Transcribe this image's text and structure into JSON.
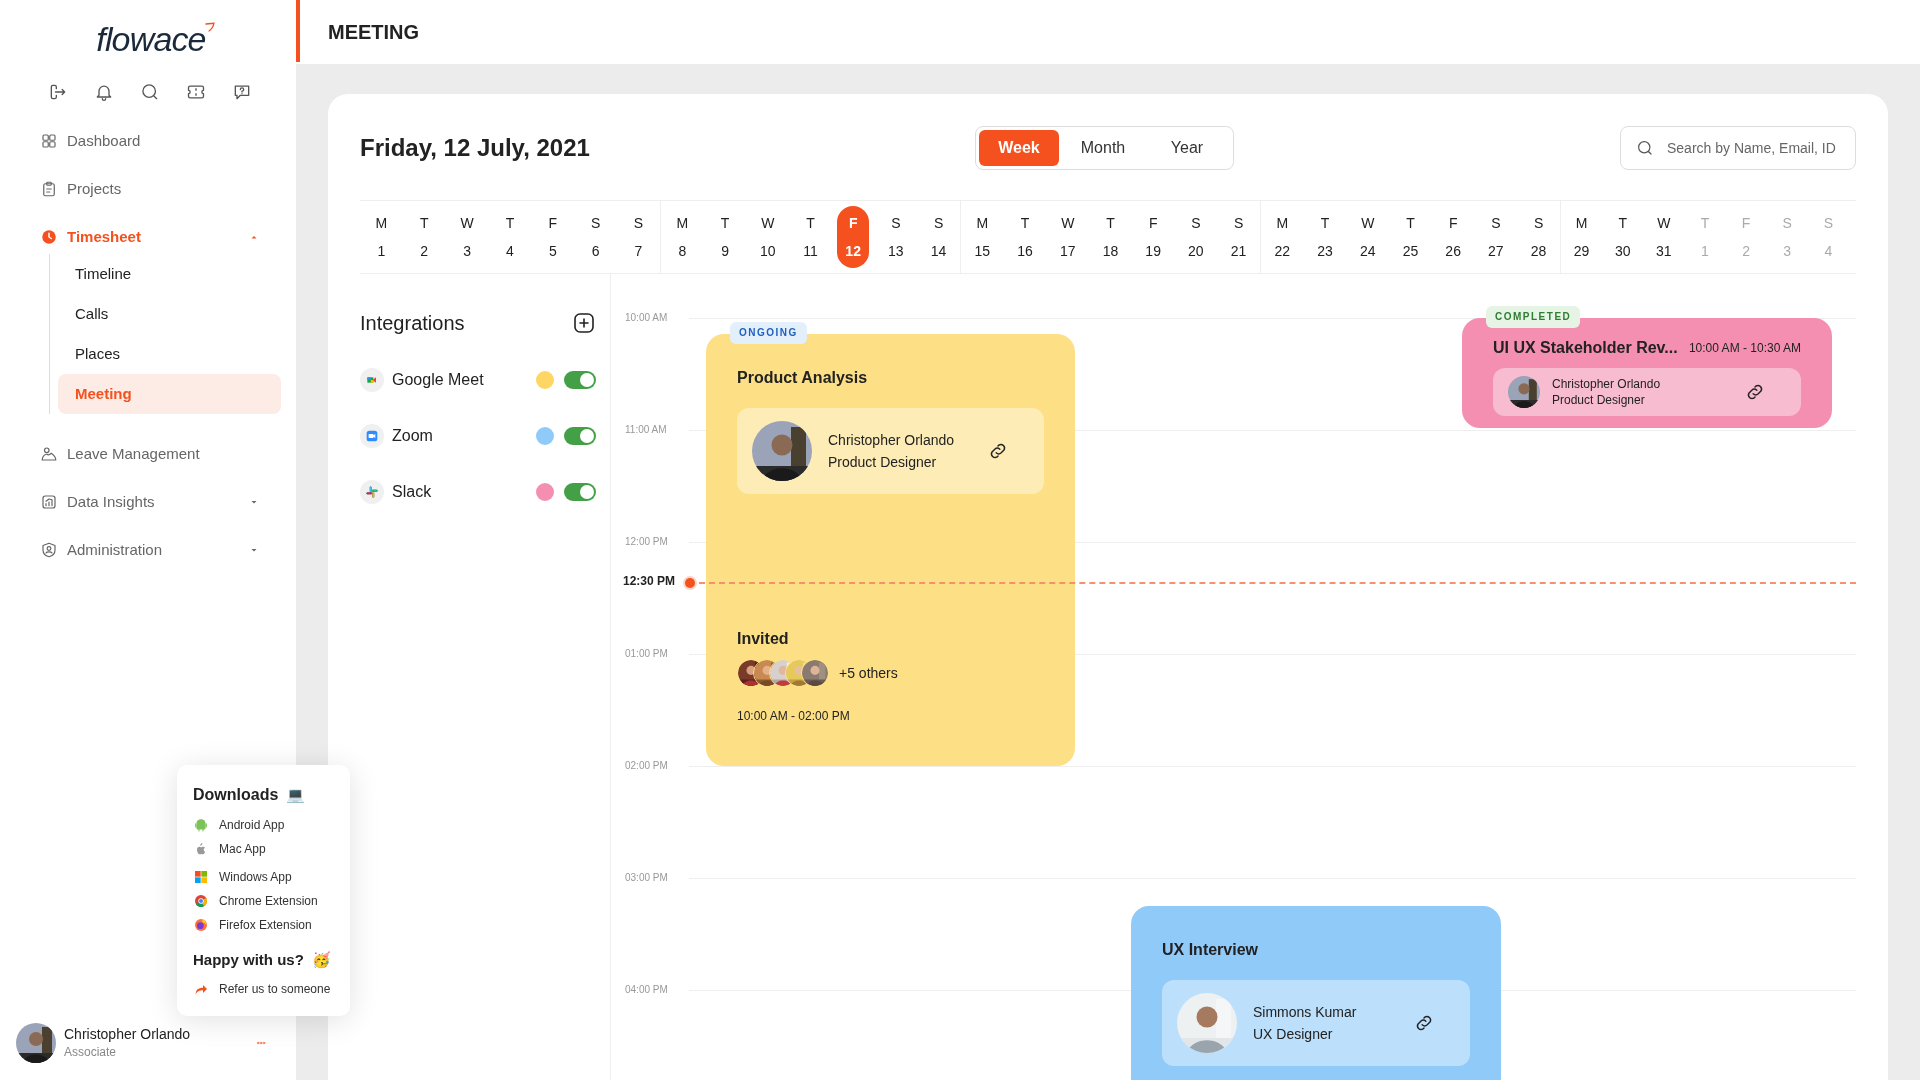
{
  "logo": "flow**ace**",
  "header_title": "MEETING",
  "nav": [
    {
      "label": "Dashboard",
      "kind": "link",
      "selected": false
    },
    {
      "label": "Projects",
      "kind": "link",
      "selected": false
    },
    {
      "label": "Timesheet",
      "kind": "group",
      "selected": true,
      "expanded": true,
      "children": [
        {
          "label": "Timeline",
          "selected": false
        },
        {
          "label": "Calls",
          "selected": false
        },
        {
          "label": "Places",
          "selected": false
        },
        {
          "label": "Meeting",
          "selected": true
        }
      ]
    },
    {
      "label": "Leave Management",
      "kind": "link",
      "selected": false
    },
    {
      "label": "Data Insights",
      "kind": "group",
      "selected": false,
      "expanded": false
    },
    {
      "label": "Administration",
      "kind": "group",
      "selected": false,
      "expanded": false
    }
  ],
  "downloads": {
    "title": "Downloads",
    "emoji": "💻",
    "items": [
      "Android App",
      "Mac App",
      "Windows App",
      "Chrome Extension",
      "Firefox Extension"
    ]
  },
  "happy": {
    "title": "Happy with us?",
    "emoji": "🥳",
    "link": "Refer us to someone"
  },
  "user": {
    "name": "Christopher Orlando",
    "role": "Associate"
  },
  "date_title": "Friday, 12 July, 2021",
  "view_toggle": [
    {
      "label": "Week",
      "selected": true
    },
    {
      "label": "Month",
      "selected": false
    },
    {
      "label": "Year",
      "selected": false
    }
  ],
  "search": {
    "placeholder": "Search by Name, Email, ID"
  },
  "calendar": {
    "weeks": [
      {
        "days": [
          {
            "letter": "M",
            "day": "1",
            "selected": false,
            "muted": false
          },
          {
            "letter": "T",
            "day": "2",
            "selected": false,
            "muted": false
          },
          {
            "letter": "W",
            "day": "3",
            "selected": false,
            "muted": false
          },
          {
            "letter": "T",
            "day": "4",
            "selected": false,
            "muted": false
          },
          {
            "letter": "F",
            "day": "5",
            "selected": false,
            "muted": false
          },
          {
            "letter": "S",
            "day": "6",
            "selected": false,
            "muted": false
          },
          {
            "letter": "S",
            "day": "7",
            "selected": false,
            "muted": false
          }
        ]
      },
      {
        "days": [
          {
            "letter": "M",
            "day": "8",
            "selected": false,
            "muted": false
          },
          {
            "letter": "T",
            "day": "9",
            "selected": false,
            "muted": false
          },
          {
            "letter": "W",
            "day": "10",
            "selected": false,
            "muted": false
          },
          {
            "letter": "T",
            "day": "11",
            "selected": false,
            "muted": false
          },
          {
            "letter": "F",
            "day": "12",
            "selected": true,
            "muted": false
          },
          {
            "letter": "S",
            "day": "13",
            "selected": false,
            "muted": false
          },
          {
            "letter": "S",
            "day": "14",
            "selected": false,
            "muted": false
          }
        ]
      },
      {
        "days": [
          {
            "letter": "M",
            "day": "15",
            "selected": false,
            "muted": false
          },
          {
            "letter": "T",
            "day": "16",
            "selected": false,
            "muted": false
          },
          {
            "letter": "W",
            "day": "17",
            "selected": false,
            "muted": false
          },
          {
            "letter": "T",
            "day": "18",
            "selected": false,
            "muted": false
          },
          {
            "letter": "F",
            "day": "19",
            "selected": false,
            "muted": false
          },
          {
            "letter": "S",
            "day": "20",
            "selected": false,
            "muted": false
          },
          {
            "letter": "S",
            "day": "21",
            "selected": false,
            "muted": false
          }
        ]
      },
      {
        "days": [
          {
            "letter": "M",
            "day": "22",
            "selected": false,
            "muted": false
          },
          {
            "letter": "T",
            "day": "23",
            "selected": false,
            "muted": false
          },
          {
            "letter": "W",
            "day": "24",
            "selected": false,
            "muted": false
          },
          {
            "letter": "T",
            "day": "25",
            "selected": false,
            "muted": false
          },
          {
            "letter": "F",
            "day": "26",
            "selected": false,
            "muted": false
          },
          {
            "letter": "S",
            "day": "27",
            "selected": false,
            "muted": false
          },
          {
            "letter": "S",
            "day": "28",
            "selected": false,
            "muted": false
          }
        ]
      },
      {
        "days": [
          {
            "letter": "M",
            "day": "29",
            "selected": false,
            "muted": false
          },
          {
            "letter": "T",
            "day": "30",
            "selected": false,
            "muted": false
          },
          {
            "letter": "W",
            "day": "31",
            "selected": false,
            "muted": false
          },
          {
            "letter": "T",
            "day": "1",
            "selected": false,
            "muted": true
          },
          {
            "letter": "F",
            "day": "2",
            "selected": false,
            "muted": true
          },
          {
            "letter": "S",
            "day": "3",
            "selected": false,
            "muted": true
          },
          {
            "letter": "S",
            "day": "4",
            "selected": false,
            "muted": true
          }
        ]
      }
    ]
  },
  "integrations": {
    "title": "Integrations",
    "items": [
      {
        "name": "Google Meet",
        "color": "#fdd663",
        "on": true
      },
      {
        "name": "Zoom",
        "color": "#90caf9",
        "on": true
      },
      {
        "name": "Slack",
        "color": "#f48fb1",
        "on": true
      }
    ]
  },
  "timeline": {
    "hours": [
      "10:00 AM",
      "11:00 AM",
      "12:00 PM",
      "01:00 PM",
      "02:00 PM",
      "03:00 PM",
      "04:00 PM"
    ],
    "now": "12:30 PM",
    "events": [
      {
        "title": "Product Analysis",
        "color": "#fde085",
        "status": {
          "kind": "ongoing",
          "label": "ONGOING"
        },
        "person": {
          "name": "Christopher Orlando",
          "role": "Product Designer"
        },
        "invited": {
          "title": "Invited",
          "others": "+5 others"
        },
        "time": "10:00 AM - 02:00 PM"
      },
      {
        "title": "UI UX Stakeholder Rev...",
        "color": "#f48fb1",
        "status": {
          "kind": "completed",
          "label": "COMPLETED"
        },
        "person": {
          "name": "Christopher Orlando",
          "role": "Product Designer"
        },
        "time": "10:00 AM - 10:30 AM"
      },
      {
        "title": "UX Interview",
        "color": "#90caf9",
        "person": {
          "name": "Simmons Kumar",
          "role": "UX Designer"
        }
      }
    ]
  }
}
